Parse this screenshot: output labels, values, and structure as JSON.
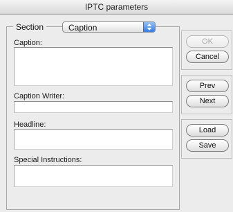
{
  "window": {
    "title": "IPTC parameters"
  },
  "section": {
    "label": "Section",
    "selected": "Caption"
  },
  "fields": {
    "caption": {
      "label": "Caption:",
      "value": ""
    },
    "caption_writer": {
      "label": "Caption Writer:",
      "value": ""
    },
    "headline": {
      "label": "Headline:",
      "value": ""
    },
    "special_instructions": {
      "label": "Special Instructions:",
      "value": ""
    }
  },
  "buttons": {
    "ok": "OK",
    "cancel": "Cancel",
    "prev": "Prev",
    "next": "Next",
    "load": "Load",
    "save": "Save"
  }
}
